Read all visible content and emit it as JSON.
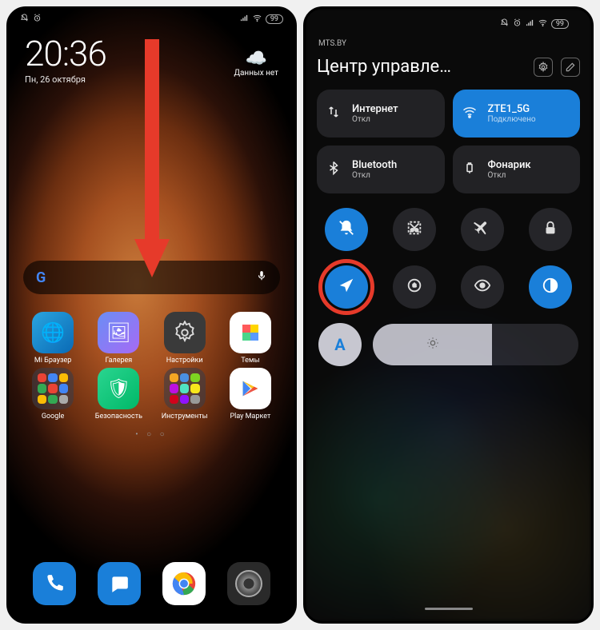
{
  "home": {
    "time": "20:36",
    "date": "Пн, 26 октября",
    "weather_label": "Данных нет",
    "battery": "99",
    "apps": [
      {
        "label": "Mi Браузер",
        "bg": "linear-gradient(135deg,#2aa5e0,#0a6ab5)",
        "glyph": "🌐"
      },
      {
        "label": "Галерея",
        "bg": "linear-gradient(135deg,#6a8ef5,#a66af5)",
        "glyph": "🖼"
      },
      {
        "label": "Настройки",
        "bg": "#3a3a3a",
        "glyph": "⚙"
      },
      {
        "label": "Темы",
        "bg": "#fff",
        "glyph": "🎨"
      },
      {
        "label": "Google",
        "folder": true,
        "minis": [
          "#ea4335",
          "#4285f4",
          "#fbbc05",
          "#34a853",
          "#ea4335",
          "#4285f4",
          "#fbbc05",
          "#34a853",
          "#aaa"
        ]
      },
      {
        "label": "Безопасность",
        "bg": "linear-gradient(135deg,#2ad590,#00b868)",
        "glyph": "🛡"
      },
      {
        "label": "Инструменты",
        "folder": true,
        "minis": [
          "#f5a623",
          "#4a90e2",
          "#7ed321",
          "#bd10e0",
          "#50e3c2",
          "#f8e71c",
          "#d0021b",
          "#9013fe",
          "#999"
        ]
      },
      {
        "label": "Play Маркет",
        "bg": "#fff",
        "glyph": "▶"
      }
    ],
    "dock": [
      {
        "name": "phone",
        "bg": "#1a7fd9",
        "glyph": "📞"
      },
      {
        "name": "messages",
        "bg": "#1a7fd9",
        "glyph": "💬"
      },
      {
        "name": "chrome",
        "bg": "#fff",
        "glyph": "C"
      },
      {
        "name": "camera",
        "bg": "#2a2a2a",
        "glyph": "📷"
      }
    ]
  },
  "cc": {
    "carrier": "MTS.BY",
    "battery": "99",
    "title": "Центр управле…",
    "tiles": [
      {
        "name": "Интернет",
        "status": "Откл",
        "icon": "⇅",
        "active": false
      },
      {
        "name": "ZTE1_5G",
        "status": "Подключено",
        "icon": "wifi",
        "active": true
      },
      {
        "name": "Bluetooth",
        "status": "Откл",
        "icon": "bt",
        "active": false
      },
      {
        "name": "Фонарик",
        "status": "Откл",
        "icon": "flash",
        "active": false
      }
    ],
    "toggles": [
      {
        "name": "mute",
        "active": true,
        "icon": "bell-off"
      },
      {
        "name": "screenshot",
        "active": false,
        "icon": "snip"
      },
      {
        "name": "airplane",
        "active": false,
        "icon": "plane"
      },
      {
        "name": "lock",
        "active": false,
        "icon": "lock"
      },
      {
        "name": "location",
        "active": true,
        "icon": "nav",
        "highlight": true
      },
      {
        "name": "rotate-lock",
        "active": false,
        "icon": "rotate"
      },
      {
        "name": "eye-comfort",
        "active": false,
        "icon": "eye"
      },
      {
        "name": "dark-mode",
        "active": true,
        "icon": "contrast"
      }
    ],
    "auto_brightness_label": "A"
  }
}
